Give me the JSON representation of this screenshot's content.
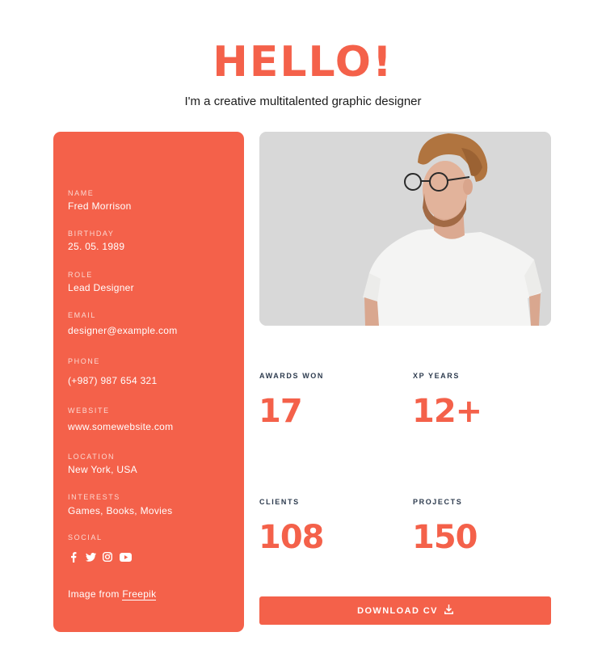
{
  "hero": {
    "title": "HELLO!",
    "subtitle": "I'm a creative multitalented graphic designer"
  },
  "profile": {
    "name_label": "NAME",
    "name": "Fred Morrison",
    "birthday_label": "BIRTHDAY",
    "birthday": "25. 05. 1989",
    "role_label": "ROLE",
    "role": "Lead Designer",
    "email_label": "EMAIL",
    "email": "designer@example.com",
    "phone_label": "PHONE",
    "phone": "(+987) 987 654 321",
    "website_label": "WEBSITE",
    "website": "www.somewebsite.com",
    "location_label": "LOCATION",
    "location": "New York, USA",
    "interests_label": "INTERESTS",
    "interests": "Games, Books, Movies",
    "social_label": "SOCIAL",
    "social_icons": [
      "facebook-icon",
      "twitter-icon",
      "instagram-icon",
      "youtube-icon"
    ],
    "credit_prefix": "Image from",
    "credit_link": "Freepik"
  },
  "stats": {
    "awards_label": "AWARDS WON",
    "awards": "17",
    "xp_label": "XP YEARS",
    "xp": "12+",
    "clients_label": "CLIENTS",
    "clients": "108",
    "projects_label": "PROJECTS",
    "projects": "150"
  },
  "cta": {
    "download_label": "DOWNLOAD CV",
    "icon": "download-icon"
  },
  "colors": {
    "accent": "#f4614a",
    "photo_bg": "#d9d9d9",
    "label_dark": "#2d3b4e"
  }
}
